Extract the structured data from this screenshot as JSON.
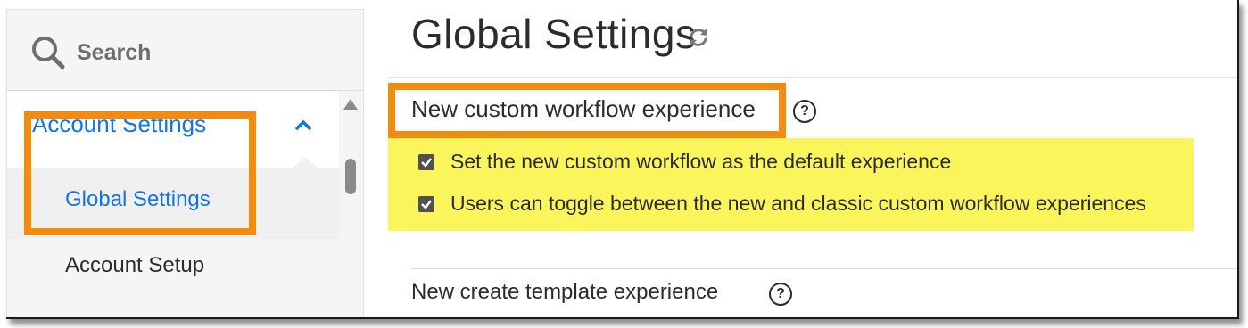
{
  "search": {
    "placeholder": "Search"
  },
  "sidebar": {
    "group_label": "Account Settings",
    "active_item": "Global Settings",
    "items": [
      "Account Setup"
    ]
  },
  "main": {
    "title": "Global Settings",
    "section1": {
      "title": "New custom workflow experience",
      "options": [
        {
          "label": "Set the new custom workflow as the default experience",
          "checked": true
        },
        {
          "label": "Users can toggle between the new and classic custom workflow experiences",
          "checked": true
        }
      ]
    },
    "section2": {
      "title": "New create template experience"
    },
    "help_glyph": "?"
  },
  "colors": {
    "accent": "#1473e6",
    "highlight_orange": "#f58a0b",
    "highlight_yellow": "#fbf55c"
  },
  "icons": [
    "search-icon",
    "chevron-up-icon",
    "refresh-icon",
    "help-icon",
    "checkbox-icon"
  ]
}
